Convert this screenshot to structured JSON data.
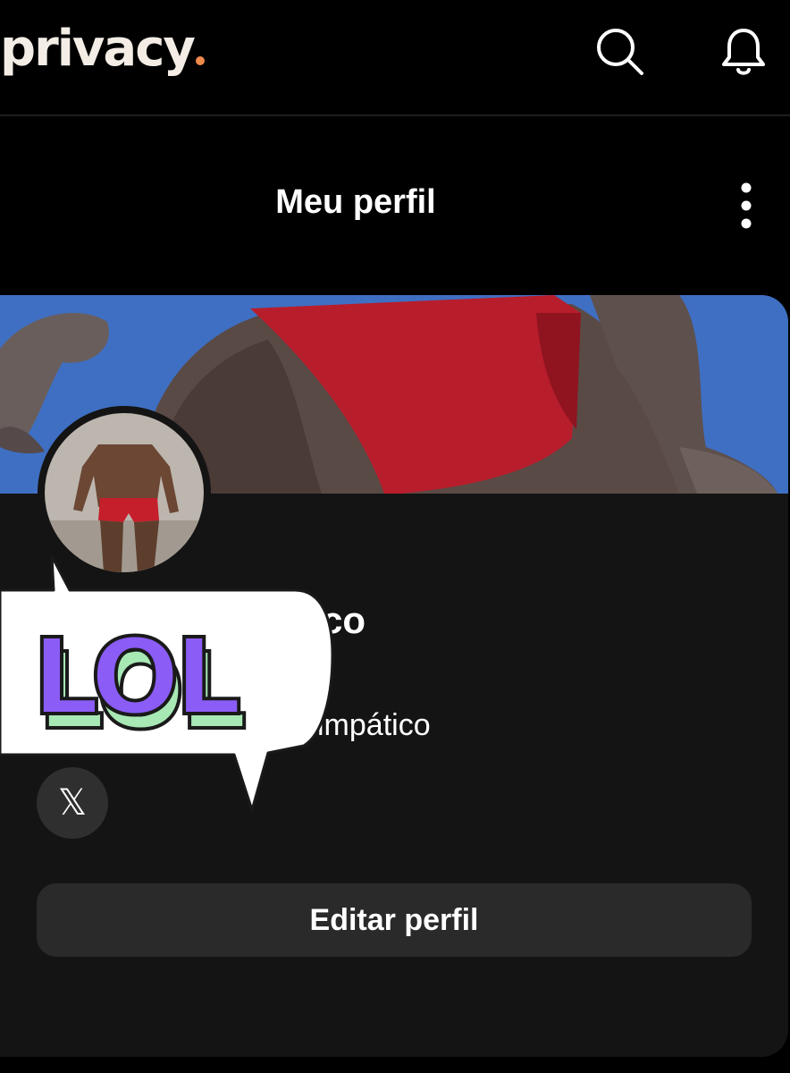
{
  "header": {
    "logo_text": "privacy",
    "brand_dot_color": "#f08a4b",
    "icons": [
      "search-icon",
      "bell-icon"
    ]
  },
  "profile_page": {
    "title": "Meu perfil",
    "menu_icon": "kebab-menu-icon",
    "name_visible": "sico",
    "bio_visible": "impático",
    "social_icon": "x-logo-icon",
    "social_label": "𝕏",
    "edit_button_label": "Editar perfil"
  },
  "sticker": {
    "text": "LOL",
    "fill_color": "#8b5cf6",
    "shadow_color": "#a7e8b4"
  }
}
